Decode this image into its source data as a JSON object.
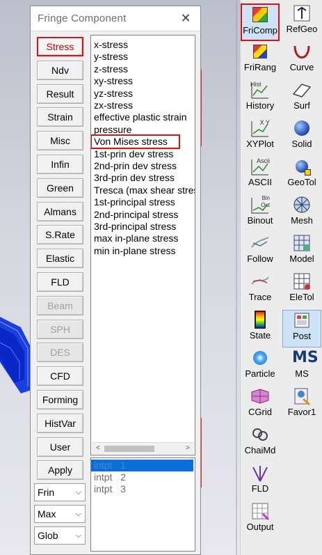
{
  "dialog": {
    "title": "Fringe Component",
    "categories": [
      {
        "label": "Stress",
        "state": "active"
      },
      {
        "label": "Ndv",
        "state": "normal"
      },
      {
        "label": "Result",
        "state": "normal"
      },
      {
        "label": "Strain",
        "state": "normal"
      },
      {
        "label": "Misc",
        "state": "normal"
      },
      {
        "label": "Infin",
        "state": "normal"
      },
      {
        "label": "Green",
        "state": "normal"
      },
      {
        "label": "Almans",
        "state": "normal"
      },
      {
        "label": "S.Rate",
        "state": "normal"
      },
      {
        "label": "Elastic",
        "state": "normal"
      },
      {
        "label": "FLD",
        "state": "normal"
      },
      {
        "label": "Beam",
        "state": "disabled"
      },
      {
        "label": "SPH",
        "state": "disabled"
      },
      {
        "label": "DES",
        "state": "disabled"
      },
      {
        "label": "CFD",
        "state": "normal"
      },
      {
        "label": "Forming",
        "state": "normal"
      },
      {
        "label": "HistVar",
        "state": "normal"
      },
      {
        "label": "User",
        "state": "normal"
      },
      {
        "label": "Apply",
        "state": "normal"
      }
    ],
    "dropdowns": [
      {
        "value": "Frin"
      },
      {
        "value": "Max"
      },
      {
        "value": "Glob"
      }
    ],
    "components": [
      "x-stress",
      "y-stress",
      "z-stress",
      "xy-stress",
      "yz-stress",
      "zx-stress",
      "effective plastic strain",
      "pressure",
      "Von Mises stress",
      "1st-prin dev stress",
      "2nd-prin dev stress",
      "3rd-prin dev stress",
      "Tresca (max shear stress)",
      "1st-principal stress",
      "2nd-principal stress",
      "3rd-principal stress",
      "max in-plane stress",
      "min in-plane stress"
    ],
    "highlighted_component": "Von Mises stress",
    "integration_points": [
      "intpt   1",
      "intpt   2",
      "intpt   3"
    ],
    "selected_integration_point": "intpt   1",
    "scroll_left_arrow": "<",
    "scroll_right_arrow": ">"
  },
  "toolbar": {
    "left_column": [
      "FriComp",
      "FriRang",
      "History",
      "XYPlot",
      "ASCII",
      "Binout",
      "Follow",
      "Trace",
      "State",
      "Particle",
      "CGrid",
      "ChaiMd",
      "FLD",
      "Output"
    ],
    "right_column": [
      "RefGeo",
      "Curve",
      "Surf",
      "Solid",
      "GeoTol",
      "Mesh",
      "Model",
      "EleTol",
      "Post",
      "MS",
      "Favor1"
    ],
    "boxed_tool": "FriComp",
    "selected_tool": "Post"
  },
  "colors": {
    "accent_red": "#dd1111",
    "selection_blue": "#0a70d8",
    "mesh_blue": "#1437e8"
  }
}
